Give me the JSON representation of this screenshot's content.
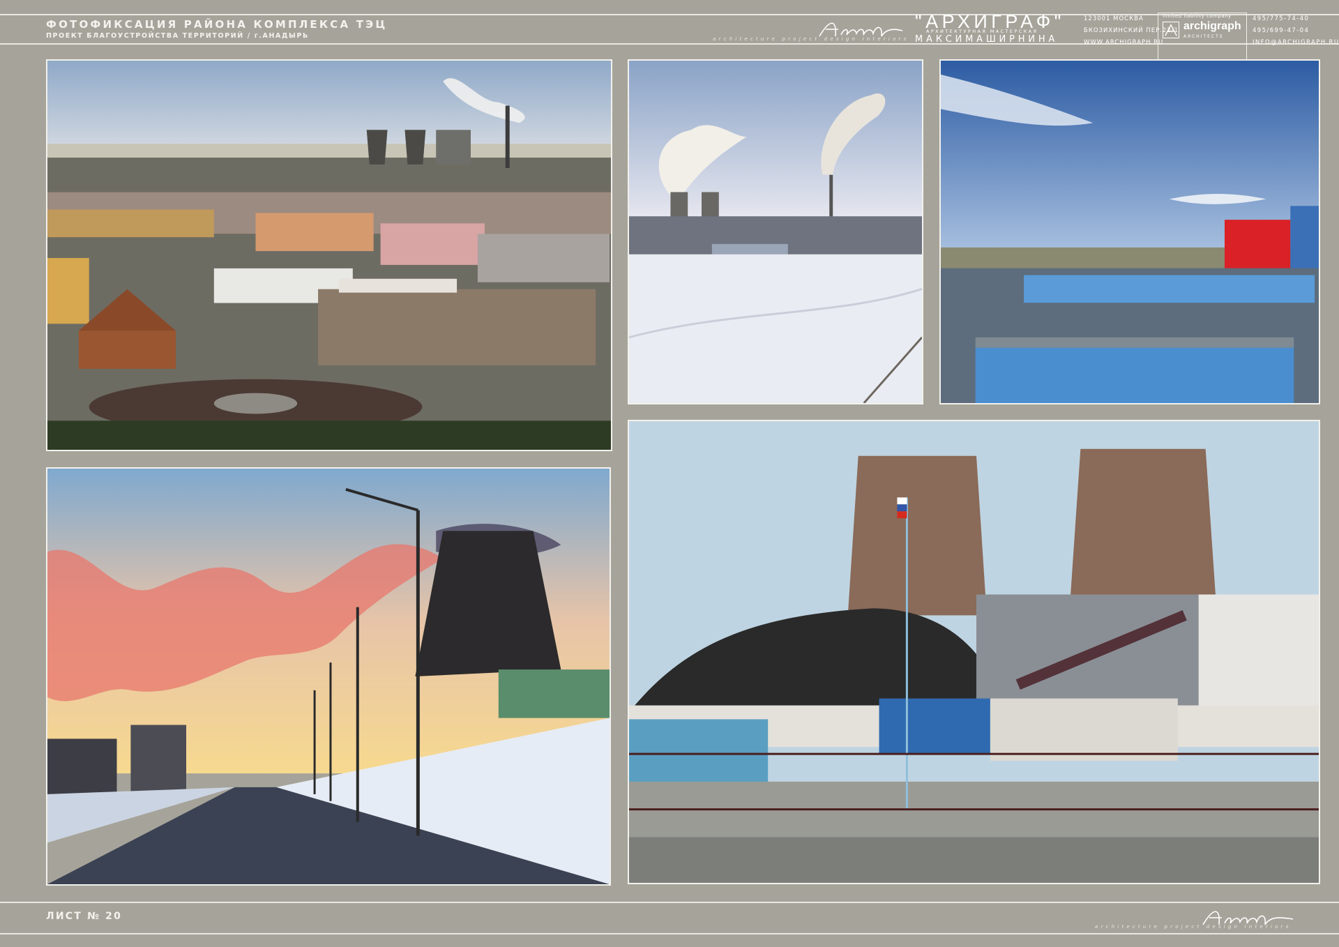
{
  "header": {
    "title": "ФОТОФИКСАЦИЯ РАЙОНА КОМПЛЕКСА ТЭЦ",
    "subtitle": "ПРОЕКТ БЛАГОУСТРОЙСТВА ТЕРРИТОРИЙ / г.АНАДЫРЬ",
    "signature_caption": "architecture project design interiors"
  },
  "brand": {
    "name": "\"АРХИГРАФ\"",
    "tagline": "АРХИТЕКТУРНАЯ МАСТЕРСКАЯ",
    "person": "МАКСИМАШИРНИНА",
    "address_lines": [
      "123001 МОСКВА",
      "БКОЗИХИНСКИЙ ПЕР.22/1",
      "WWW.ARCHIGRAPH.RU"
    ],
    "ltd_caption": "limited liability company",
    "ltd_name": "archigraph",
    "ltd_sub": "ARCHITECTS",
    "phones": [
      "495/775-74-40",
      "495/699-47-04",
      "INFO@ARCHIGRAPH.RU"
    ]
  },
  "footer": {
    "sheet_label": "ЛИСТ № 20",
    "signature_caption": "architecture project design interiors"
  },
  "colors": {
    "background": "#a6a49a",
    "rule": "#e8e7e1",
    "frame": "#f2f1ec"
  }
}
